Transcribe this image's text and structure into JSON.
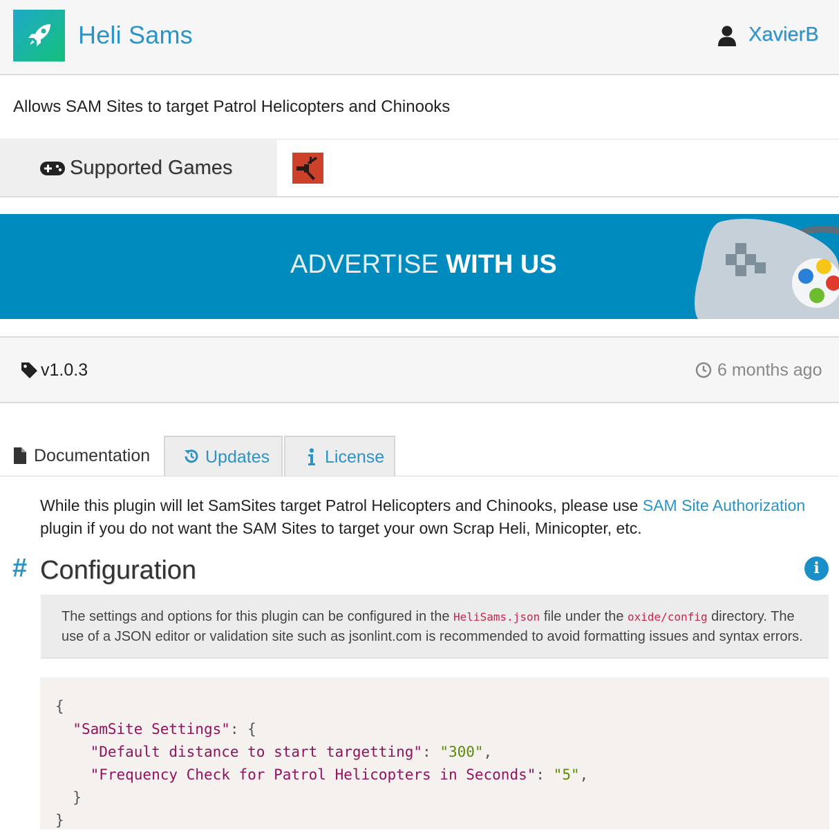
{
  "header": {
    "plugin_title": "Heli Sams",
    "author": "XavierB",
    "logo_icon": "rocket-icon",
    "user_icon": "user-icon"
  },
  "description": "Allows SAM Sites to target Patrol Helicopters and Chinooks",
  "supported_games": {
    "label": "Supported Games",
    "icon": "gamepad-icon",
    "games": [
      "rust-game-icon"
    ]
  },
  "banner": {
    "text_light": "ADVERTISE ",
    "text_bold": "WITH US"
  },
  "release": {
    "version": "v1.0.3",
    "updated": "6 months ago"
  },
  "tabs": [
    {
      "label": "Documentation",
      "icon": "file-icon",
      "active": true
    },
    {
      "label": "Updates",
      "icon": "history-icon",
      "active": false
    },
    {
      "label": "License",
      "icon": "info-icon",
      "active": false
    }
  ],
  "docs": {
    "intro_before": "While this plugin will let SamSites target Patrol Helicopters and Chinooks, please use ",
    "intro_link": "SAM Site Authorization",
    "intro_after": " plugin if you do not want the SAM Sites to target your own Scrap Heli, Minicopter, etc.",
    "section_hash": "#",
    "section_title": "Configuration",
    "note_1": "The settings and options for this plugin can be configured in the ",
    "note_file": "HeliSams.json",
    "note_2": " file under the ",
    "note_dir": "oxide/config",
    "note_3": " directory. The use of a JSON editor or validation site such as jsonlint.com is recommended to avoid formatting issues and syntax errors.",
    "code": {
      "open": "{",
      "group_key": "\"SamSite Settings\"",
      "key1": "\"Default distance to start targetting\"",
      "val1": "\"300\"",
      "key2": "\"Frequency Check for Patrol Helicopters in Seconds\"",
      "val2": "\"5\"",
      "close_inner": "}",
      "close": "}"
    }
  },
  "colors": {
    "accent": "#2b93c6",
    "banner": "#008bbf",
    "rust": "#cd412b"
  }
}
